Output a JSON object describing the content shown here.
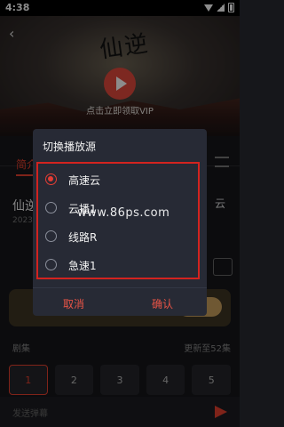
{
  "statusbar": {
    "time": "4:38"
  },
  "video": {
    "title_art": "仙逆",
    "vip_hint": "点击立即领取VIP"
  },
  "page": {
    "tab_intro": "简介",
    "show_title": "仙逆",
    "show_meta": "2023",
    "right_chip": "云",
    "episodes_label": "剧集",
    "episodes_more": "更新至52集",
    "episodes": [
      "1",
      "2",
      "3",
      "4",
      "5"
    ],
    "comment_placeholder": "发送弹幕"
  },
  "dialog": {
    "title": "切换播放源",
    "options": [
      {
        "label": "高速云",
        "selected": true
      },
      {
        "label": "云播1",
        "selected": false
      },
      {
        "label": "线路R",
        "selected": false
      },
      {
        "label": "急速1",
        "selected": false
      }
    ],
    "cancel_label": "取消",
    "confirm_label": "确认",
    "highlight_color": "#d3231f"
  },
  "watermark": "www.86ps.com",
  "colors": {
    "accent": "#e8412e"
  }
}
